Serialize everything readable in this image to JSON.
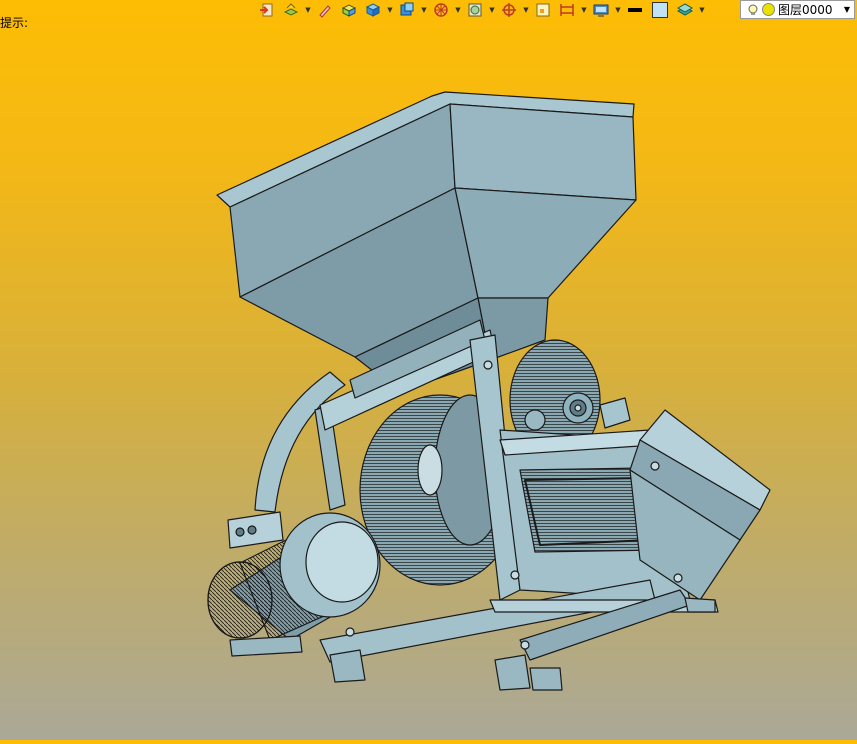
{
  "status": {
    "hint_text": "提示:"
  },
  "layer": {
    "name": "图层0000"
  },
  "toolbar": {
    "icons": [
      "import-icon",
      "layers-tool-icon",
      "pen-icon",
      "solid-box-icon",
      "cube-icon",
      "view-cube-icon",
      "wheel-icon",
      "render-icon",
      "target-icon",
      "frame-icon",
      "dimension-icon",
      "display-icon",
      "line-color",
      "fill-color",
      "layer-stack-icon"
    ]
  },
  "colors": {
    "bg_top": "#fdbd04",
    "bg_bottom": "#aaa898",
    "model_fill": "#8fb2bf",
    "model_edge": "#1a1a1a"
  }
}
